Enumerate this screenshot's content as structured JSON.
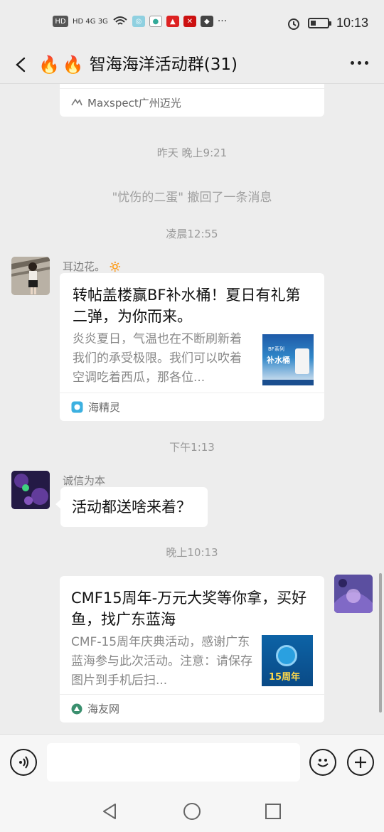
{
  "status_bar": {
    "left_text": "HD 4G 3G",
    "time": "10:13"
  },
  "header": {
    "flame1": "🔥",
    "flame2": "🔥",
    "title": "智海海洋活动群(31)"
  },
  "messages": {
    "top_card_source": "Maxspect广州迈光",
    "ts1": "昨天 晚上9:21",
    "recall": "\"忧伤的二蛋\" 撤回了一条消息",
    "ts2": "凌晨12:55",
    "msg1": {
      "sender": "耳边花。",
      "sender_emoji": "🔅",
      "title": "转帖盖楼赢BF补水桶！夏日有礼第二弹，为你而来。",
      "desc": "炎炎夏日，气温也在不断刷新着我们的承受极限。我们可以吹着空调吃着西瓜，那各位...",
      "thumb_text_small": "BF系列",
      "thumb_text": "补水桶",
      "source": "海精灵"
    },
    "ts3": "下午1:13",
    "msg2": {
      "sender": "诚信为本",
      "text": "活动都送啥来着？"
    },
    "ts4": "晚上10:13",
    "msg3": {
      "title": "CMF15周年-万元大奖等你拿，买好鱼，找广东蓝海",
      "desc": "CMF-15周年庆典活动，感谢广东蓝海参与此次活动。注意：请保存图片到手机后扫...",
      "thumb_text": "15周年",
      "source": "海友网"
    }
  },
  "colors": {
    "background": "#ededed",
    "card": "#ffffff",
    "timestamp": "#999999",
    "source_text": "#666666"
  }
}
